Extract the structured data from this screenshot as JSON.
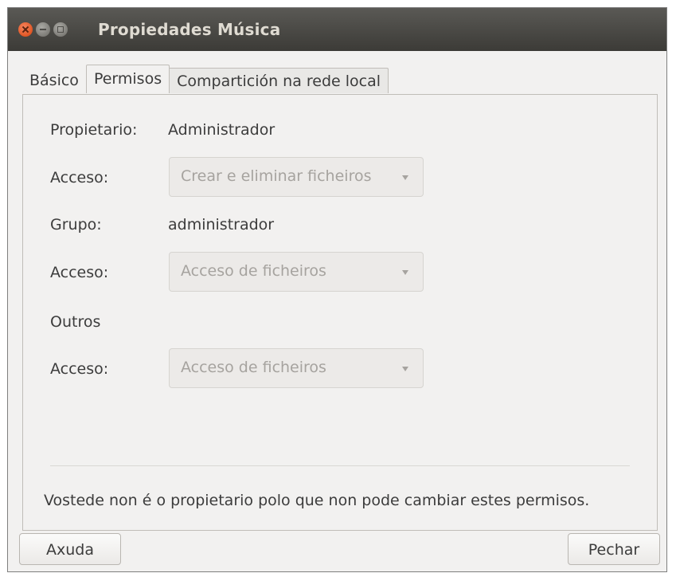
{
  "window": {
    "title": "Propiedades Música"
  },
  "tabs": [
    {
      "label": "Básico",
      "active": false
    },
    {
      "label": "Permisos",
      "active": true
    },
    {
      "label": "Compartición na rede local",
      "active": false
    }
  ],
  "permissions": {
    "owner": {
      "label": "Propietario:",
      "value": "Administrador",
      "access_label": "Acceso:",
      "access_value": "Crear e eliminar ficheiros"
    },
    "group": {
      "label": "Grupo:",
      "value": "administrador",
      "access_label": "Acceso:",
      "access_value": "Acceso de ficheiros"
    },
    "others": {
      "label": "Outros",
      "access_label": "Acceso:",
      "access_value": "Acceso de ficheiros"
    }
  },
  "note": "Vostede non é o propietario polo que non pode cambiar estes permisos.",
  "buttons": {
    "help": "Axuda",
    "close": "Pechar"
  }
}
